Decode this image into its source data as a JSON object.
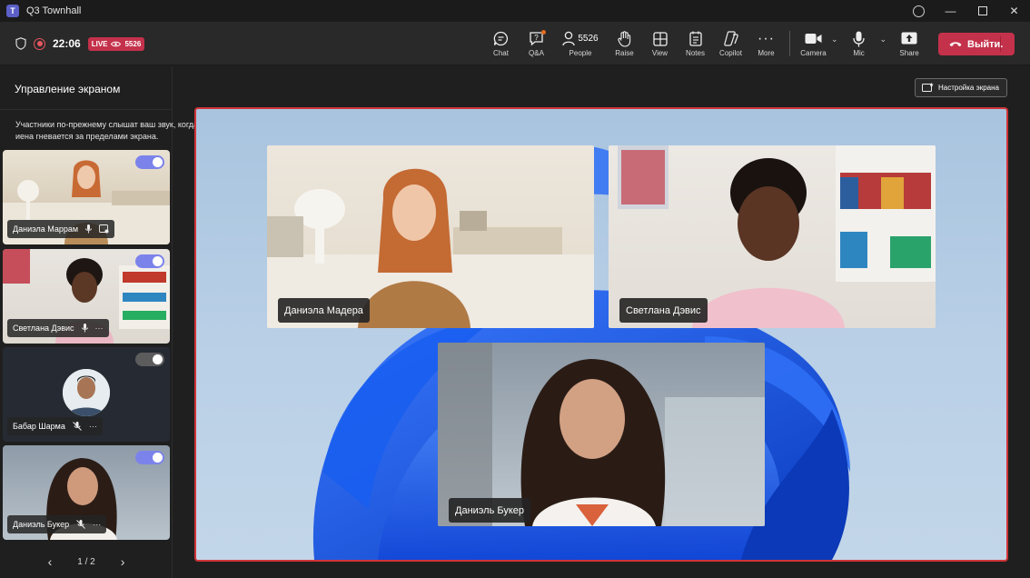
{
  "window": {
    "title": "Q3 Townhall"
  },
  "meeting": {
    "timer": "22:06",
    "live_label": "LIVE",
    "viewer_count": "5526"
  },
  "toolbar": {
    "chat": "Chat",
    "qa": "Q&A",
    "people": "People",
    "people_count": "5526",
    "raise": "Raise",
    "view": "View",
    "notes": "Notes",
    "copilot": "Copilot",
    "more": "More",
    "camera": "Camera",
    "mic": "Mic",
    "share": "Share",
    "leave": "Выйти."
  },
  "panel": {
    "title": "Управление экраном",
    "description": "Участники по-прежнему слышат ваш звук, когда иена гневается за пределами экрана.",
    "participants": [
      {
        "name": "Даниэла Маррам",
        "on_screen": true
      },
      {
        "name": "Светлана Дэвис",
        "on_screen": true
      },
      {
        "name": "Бабар Шарма",
        "on_screen": false
      },
      {
        "name": "Даниэль Букер",
        "on_screen": true
      }
    ],
    "page_indicator": "1 / 2"
  },
  "stage": {
    "settings_label": "Настройка экрана",
    "videos": [
      {
        "name": "Даниэла Мадера"
      },
      {
        "name": "Светлана Дэвис"
      },
      {
        "name": "Даниэль Букер"
      }
    ]
  },
  "colors": {
    "accent": "#7b83eb",
    "leave": "#c4314b",
    "stage_border": "#d13438",
    "live": "#c4314b"
  }
}
